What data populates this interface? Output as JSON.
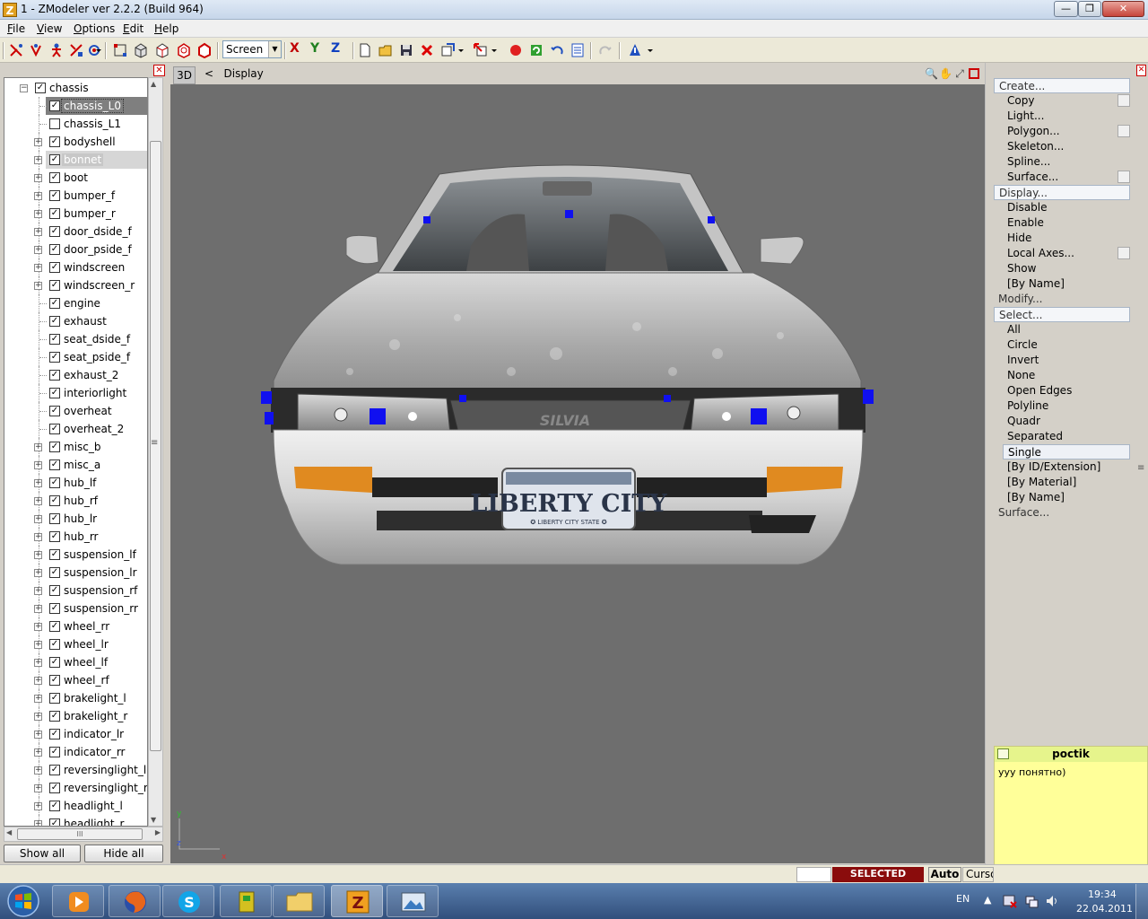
{
  "window": {
    "title": "1 - ZModeler ver 2.2.2 (Build 964)",
    "app_icon_letter": "Z",
    "controls": {
      "minimize": "—",
      "maximize": "❐",
      "close": "✕"
    }
  },
  "menu": [
    "File",
    "View",
    "Options",
    "Edit",
    "Help"
  ],
  "toolbar": {
    "coord_mode": "Screen",
    "axes": [
      "X",
      "Y",
      "Z"
    ],
    "accent_colors": {
      "x": "#c00000",
      "y": "#208020",
      "z": "#1040c0"
    }
  },
  "left_panel": {
    "close_glyph": "✕",
    "tree": [
      {
        "label": "chassis",
        "checked": true,
        "level": 0,
        "expander": "minus"
      },
      {
        "label": "chassis_L0",
        "checked": true,
        "level": 1,
        "expander": "none",
        "state": "selected"
      },
      {
        "label": "chassis_L1",
        "checked": false,
        "level": 1,
        "expander": "none"
      },
      {
        "label": "bodyshell",
        "checked": true,
        "level": 1,
        "expander": "plus"
      },
      {
        "label": "bonnet",
        "checked": true,
        "level": 1,
        "expander": "plus",
        "state": "highlight"
      },
      {
        "label": "boot",
        "checked": true,
        "level": 1,
        "expander": "plus"
      },
      {
        "label": "bumper_f",
        "checked": true,
        "level": 1,
        "expander": "plus"
      },
      {
        "label": "bumper_r",
        "checked": true,
        "level": 1,
        "expander": "plus"
      },
      {
        "label": "door_dside_f",
        "checked": true,
        "level": 1,
        "expander": "plus"
      },
      {
        "label": "door_pside_f",
        "checked": true,
        "level": 1,
        "expander": "plus"
      },
      {
        "label": "windscreen",
        "checked": true,
        "level": 1,
        "expander": "plus"
      },
      {
        "label": "windscreen_r",
        "checked": true,
        "level": 1,
        "expander": "plus"
      },
      {
        "label": "engine",
        "checked": true,
        "level": 1,
        "expander": "none"
      },
      {
        "label": "exhaust",
        "checked": true,
        "level": 1,
        "expander": "none"
      },
      {
        "label": "seat_dside_f",
        "checked": true,
        "level": 1,
        "expander": "none"
      },
      {
        "label": "seat_pside_f",
        "checked": true,
        "level": 1,
        "expander": "none"
      },
      {
        "label": "exhaust_2",
        "checked": true,
        "level": 1,
        "expander": "none"
      },
      {
        "label": "interiorlight",
        "checked": true,
        "level": 1,
        "expander": "none"
      },
      {
        "label": "overheat",
        "checked": true,
        "level": 1,
        "expander": "none"
      },
      {
        "label": "overheat_2",
        "checked": true,
        "level": 1,
        "expander": "none"
      },
      {
        "label": "misc_b",
        "checked": true,
        "level": 1,
        "expander": "plus"
      },
      {
        "label": "misc_a",
        "checked": true,
        "level": 1,
        "expander": "plus"
      },
      {
        "label": "hub_lf",
        "checked": true,
        "level": 1,
        "expander": "plus"
      },
      {
        "label": "hub_rf",
        "checked": true,
        "level": 1,
        "expander": "plus"
      },
      {
        "label": "hub_lr",
        "checked": true,
        "level": 1,
        "expander": "plus"
      },
      {
        "label": "hub_rr",
        "checked": true,
        "level": 1,
        "expander": "plus"
      },
      {
        "label": "suspension_lf",
        "checked": true,
        "level": 1,
        "expander": "plus"
      },
      {
        "label": "suspension_lr",
        "checked": true,
        "level": 1,
        "expander": "plus"
      },
      {
        "label": "suspension_rf",
        "checked": true,
        "level": 1,
        "expander": "plus"
      },
      {
        "label": "suspension_rr",
        "checked": true,
        "level": 1,
        "expander": "plus"
      },
      {
        "label": "wheel_rr",
        "checked": true,
        "level": 1,
        "expander": "plus"
      },
      {
        "label": "wheel_lr",
        "checked": true,
        "level": 1,
        "expander": "plus"
      },
      {
        "label": "wheel_lf",
        "checked": true,
        "level": 1,
        "expander": "plus"
      },
      {
        "label": "wheel_rf",
        "checked": true,
        "level": 1,
        "expander": "plus"
      },
      {
        "label": "brakelight_l",
        "checked": true,
        "level": 1,
        "expander": "plus"
      },
      {
        "label": "brakelight_r",
        "checked": true,
        "level": 1,
        "expander": "plus"
      },
      {
        "label": "indicator_lr",
        "checked": true,
        "level": 1,
        "expander": "plus"
      },
      {
        "label": "indicator_rr",
        "checked": true,
        "level": 1,
        "expander": "plus"
      },
      {
        "label": "reversinglight_l",
        "checked": true,
        "level": 1,
        "expander": "plus"
      },
      {
        "label": "reversinglight_r",
        "checked": true,
        "level": 1,
        "expander": "plus"
      },
      {
        "label": "headlight_l",
        "checked": true,
        "level": 1,
        "expander": "plus"
      },
      {
        "label": "headlight_r",
        "checked": true,
        "level": 1,
        "expander": "plus"
      }
    ],
    "show_all": "Show all",
    "hide_all": "Hide all",
    "scroll_grip": "III"
  },
  "viewport": {
    "tab": "3D",
    "back_glyph": "<",
    "title": "Display",
    "tools": [
      "🔍",
      "✋",
      "⤢",
      "◻"
    ],
    "axis_labels": {
      "y": "y",
      "z": "z",
      "x": "x"
    },
    "plate_line1": "LIBERTY CITY",
    "plate_line2": "✪ LIBERTY CITY STATE ✪",
    "badge": "SILVIA"
  },
  "right_panel": {
    "close_glyph": "✕",
    "commands": [
      {
        "label": "Create...",
        "kind": "header",
        "boxed": true
      },
      {
        "label": "Copy",
        "kind": "item",
        "box": true
      },
      {
        "label": "Light...",
        "kind": "item"
      },
      {
        "label": "Polygon...",
        "kind": "item",
        "box": true
      },
      {
        "label": "Skeleton...",
        "kind": "item"
      },
      {
        "label": "Spline...",
        "kind": "item"
      },
      {
        "label": "Surface...",
        "kind": "item",
        "box": true
      },
      {
        "label": "Display...",
        "kind": "header",
        "boxed": true
      },
      {
        "label": "Disable",
        "kind": "item"
      },
      {
        "label": "Enable",
        "kind": "item"
      },
      {
        "label": "Hide",
        "kind": "item"
      },
      {
        "label": "Local Axes...",
        "kind": "item",
        "box": true
      },
      {
        "label": "Show",
        "kind": "item"
      },
      {
        "label": "[By Name]",
        "kind": "item"
      },
      {
        "label": "Modify...",
        "kind": "header"
      },
      {
        "label": "Select...",
        "kind": "header",
        "boxed": true
      },
      {
        "label": "All",
        "kind": "item"
      },
      {
        "label": "Circle",
        "kind": "item"
      },
      {
        "label": "Invert",
        "kind": "item"
      },
      {
        "label": "None",
        "kind": "item"
      },
      {
        "label": "Open Edges",
        "kind": "item"
      },
      {
        "label": "Polyline",
        "kind": "item"
      },
      {
        "label": "Quadr",
        "kind": "item"
      },
      {
        "label": "Separated",
        "kind": "item"
      },
      {
        "label": "Single",
        "kind": "item",
        "active": true
      },
      {
        "label": "[By ID/Extension]",
        "kind": "item"
      },
      {
        "label": "[By Material]",
        "kind": "item"
      },
      {
        "label": "[By Name]",
        "kind": "item"
      },
      {
        "label": "Surface...",
        "kind": "header"
      }
    ]
  },
  "chat_note": {
    "sender": "poctik",
    "message": "ууу понятно)",
    "colors": {
      "body": "#ffff99",
      "header": "#e6f48c"
    }
  },
  "status": {
    "mode": "SELECTED MODE",
    "auto": "Auto",
    "cursor": "Cursor",
    "mode_color": "#8a0c0c"
  },
  "taskbar": {
    "apps": [
      "media-player",
      "firefox",
      "skype",
      "tool-app",
      "file-explorer",
      "zmodeler",
      "image-viewer"
    ],
    "active_app": "zmodeler",
    "language": "EN",
    "time": "19:34",
    "date": "22.04.2011"
  }
}
